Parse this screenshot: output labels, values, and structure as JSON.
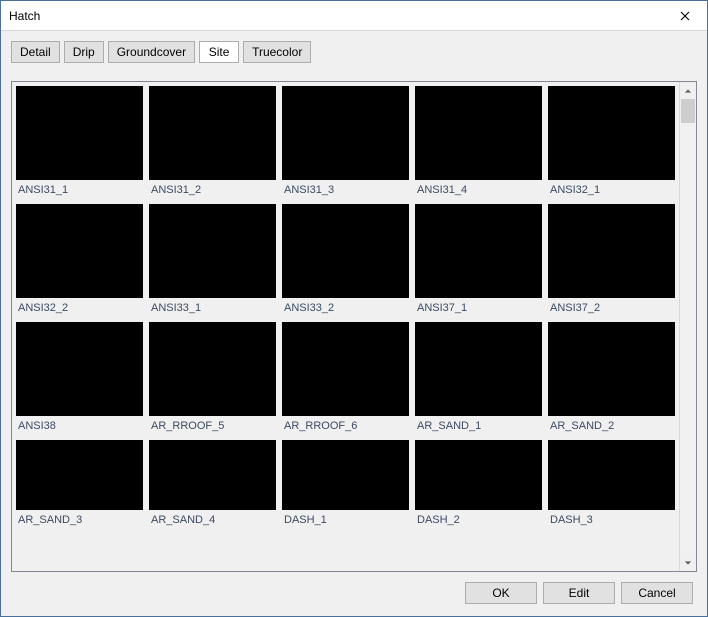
{
  "window": {
    "title": "Hatch"
  },
  "tabs": [
    {
      "label": "Detail",
      "selected": false
    },
    {
      "label": "Drip",
      "selected": false
    },
    {
      "label": "Groundcover",
      "selected": false
    },
    {
      "label": "Site",
      "selected": true
    },
    {
      "label": "Truecolor",
      "selected": false
    }
  ],
  "patterns": [
    {
      "label": "ANSI31_1"
    },
    {
      "label": "ANSI31_2"
    },
    {
      "label": "ANSI31_3"
    },
    {
      "label": "ANSI31_4"
    },
    {
      "label": "ANSI32_1"
    },
    {
      "label": "ANSI32_2"
    },
    {
      "label": "ANSI33_1"
    },
    {
      "label": "ANSI33_2"
    },
    {
      "label": "ANSI37_1"
    },
    {
      "label": "ANSI37_2"
    },
    {
      "label": "ANSI38"
    },
    {
      "label": "AR_RROOF_5"
    },
    {
      "label": "AR_RROOF_6"
    },
    {
      "label": "AR_SAND_1"
    },
    {
      "label": "AR_SAND_2"
    },
    {
      "label": "AR_SAND_3"
    },
    {
      "label": "AR_SAND_4"
    },
    {
      "label": "DASH_1"
    },
    {
      "label": "DASH_2"
    },
    {
      "label": "DASH_3"
    }
  ],
  "buttons": {
    "ok": "OK",
    "edit": "Edit",
    "cancel": "Cancel"
  }
}
